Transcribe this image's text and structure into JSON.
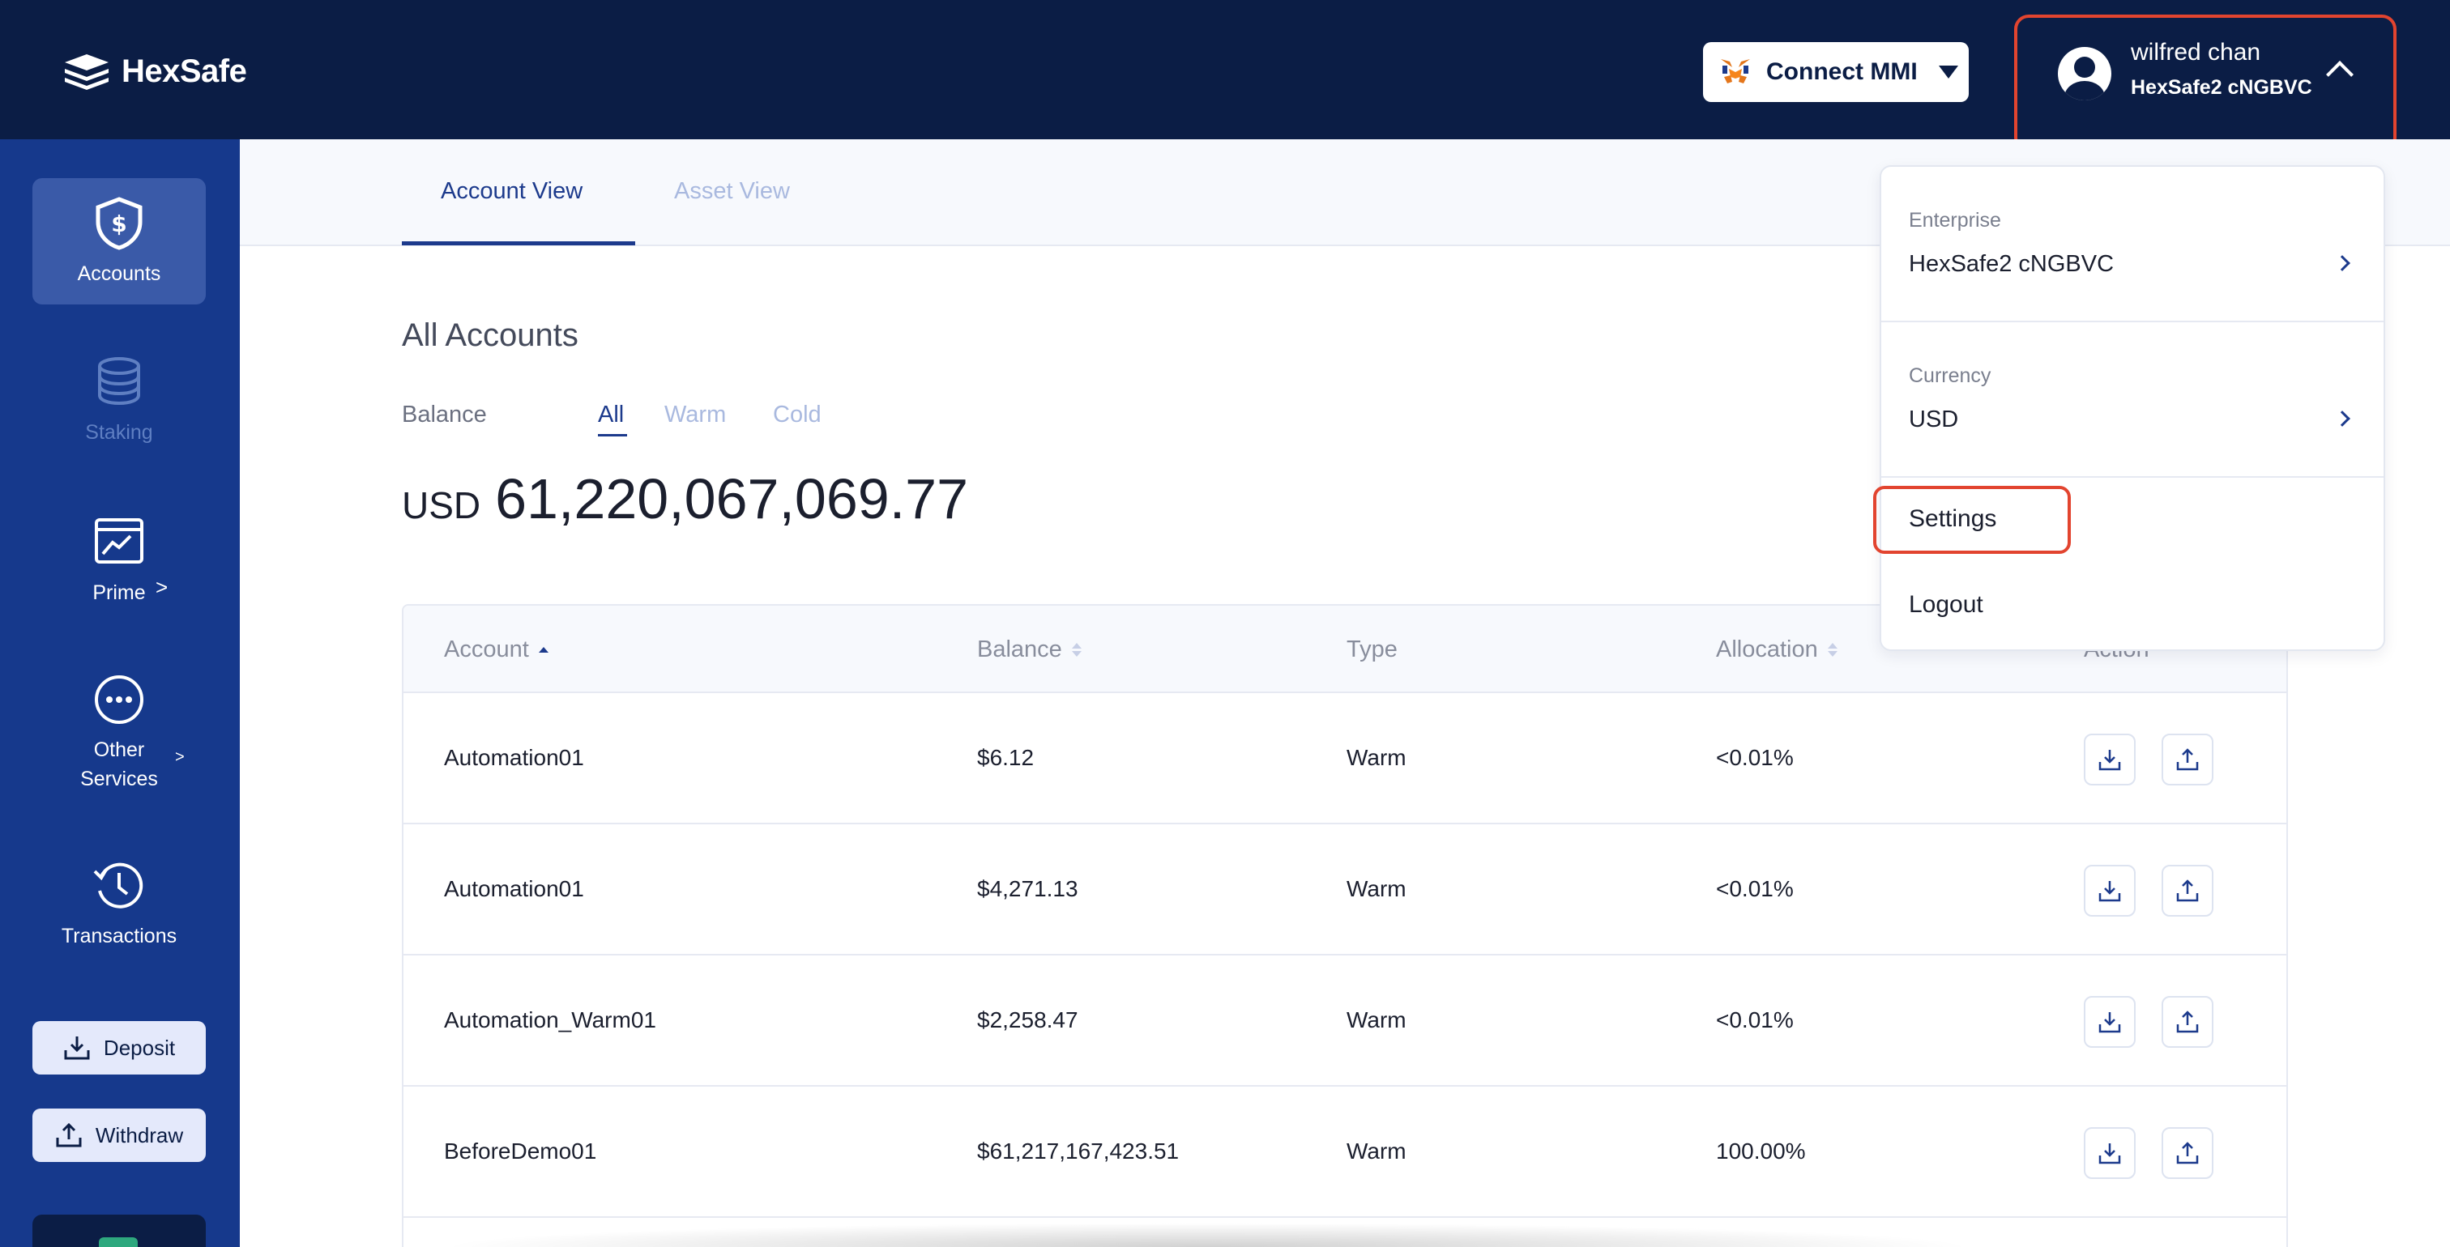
{
  "app": {
    "logo_text": "HexSafe"
  },
  "header": {
    "connect_label": "Connect MMI",
    "user_name": "wilfred chan",
    "user_org": "HexSafe2 cNGBVC"
  },
  "sidebar": {
    "items": [
      {
        "label": "Accounts",
        "icon": "shield-dollar-icon"
      },
      {
        "label": "Staking",
        "icon": "coins-stack-icon"
      },
      {
        "label": "Prime",
        "icon": "chart-window-icon"
      },
      {
        "label": "Other Services",
        "icon": "ellipsis-circle-icon"
      },
      {
        "label": "Transactions",
        "icon": "history-icon"
      }
    ],
    "prime_arrow": ">",
    "other_arrow": ">",
    "deposit_label": "Deposit",
    "withdraw_label": "Withdraw"
  },
  "tabs": [
    {
      "label": "Account View"
    },
    {
      "label": "Asset View"
    }
  ],
  "main": {
    "title": "All Accounts",
    "balance_label": "Balance",
    "filters": [
      "All",
      "Warm",
      "Cold"
    ],
    "total_currency": "USD",
    "total_amount": "61,220,067,069.77"
  },
  "table": {
    "headers": [
      "Account",
      "Balance",
      "Type",
      "Allocation",
      "Action"
    ],
    "rows": [
      {
        "account": "Automation01",
        "balance": "$6.12",
        "type": "Warm",
        "allocation": "<0.01%"
      },
      {
        "account": "Automation01",
        "balance": "$4,271.13",
        "type": "Warm",
        "allocation": "<0.01%"
      },
      {
        "account": "Automation_Warm01",
        "balance": "$2,258.47",
        "type": "Warm",
        "allocation": "<0.01%"
      },
      {
        "account": "BeforeDemo01",
        "balance": "$61,217,167,423.51",
        "type": "Warm",
        "allocation": "100.00%"
      }
    ]
  },
  "dropdown": {
    "enterprise_label": "Enterprise",
    "enterprise_value": "HexSafe2 cNGBVC",
    "currency_label": "Currency",
    "currency_value": "USD",
    "settings_label": "Settings",
    "logout_label": "Logout"
  },
  "colors": {
    "topbar": "#0b1d45",
    "sidebar": "#16398c",
    "accent": "#1c3a8c",
    "highlight": "#e2442f"
  }
}
